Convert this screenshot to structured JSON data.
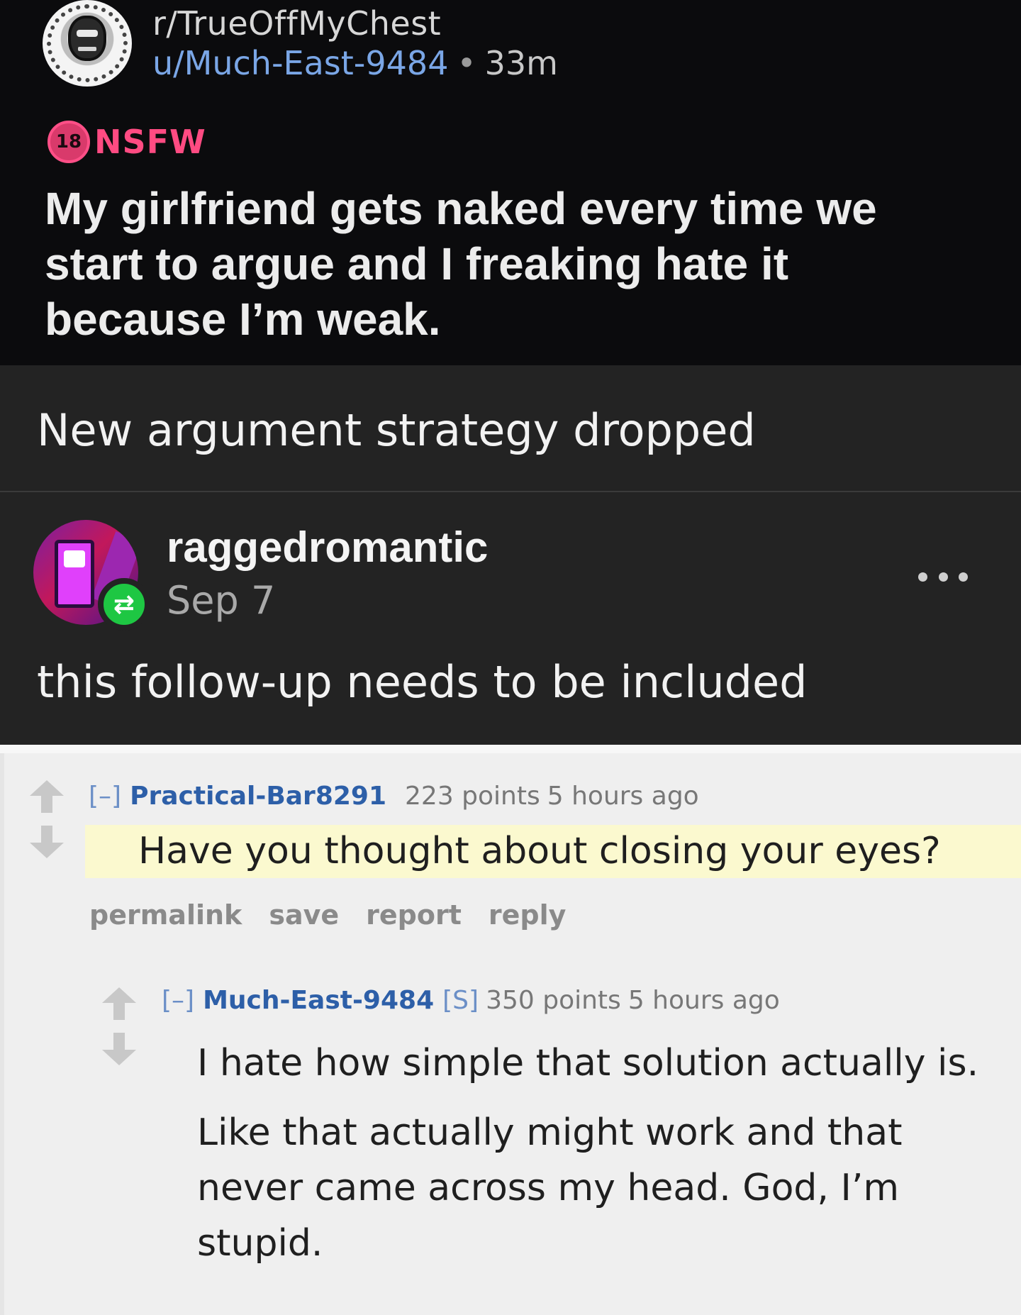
{
  "reddit": {
    "subreddit": "r/TrueOffMyChest",
    "username": "u/Much-East-9484",
    "separator": "•",
    "age": "33m",
    "nsfw_badge": "18",
    "nsfw_label": "NSFW",
    "title": "My girlfriend gets naked every time we start to argue and I freaking hate it because I’m weak."
  },
  "tumblr": {
    "caption_top": "New argument strategy dropped",
    "reblog_user": "raggedromantic",
    "reblog_date": "Sep 7",
    "reblog_icon": "reblog-icon",
    "reblog_color": "#1ec743",
    "caption_bottom": "this follow-up needs to be included"
  },
  "comments": {
    "first": {
      "toggle": "[–]",
      "author": "Practical-Bar8291",
      "score": "223 points",
      "time": "5 hours ago",
      "body": "Have you thought about closing your eyes?",
      "actions": [
        "permalink",
        "save",
        "report",
        "reply"
      ]
    },
    "second": {
      "toggle": "[–]",
      "author": "Much-East-9484",
      "flair": "[S]",
      "score": "350 points",
      "time": "5 hours ago",
      "body_p1": "I hate how simple that solution actually is.",
      "body_p2": "Like that actually might work and that never came across my head. God, I’m stupid."
    }
  }
}
